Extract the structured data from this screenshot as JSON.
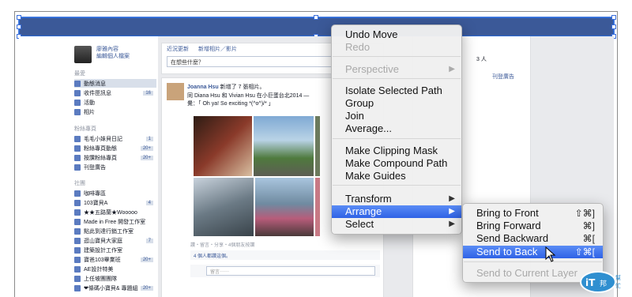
{
  "context_menu": {
    "items": [
      {
        "label": "Undo Move",
        "disabled": false
      },
      {
        "label": "Redo",
        "disabled": true
      },
      {
        "label": "Perspective",
        "disabled": true,
        "submenu": true
      },
      {
        "label": "Isolate Selected Path",
        "disabled": false
      },
      {
        "label": "Group",
        "disabled": false
      },
      {
        "label": "Join",
        "disabled": false
      },
      {
        "label": "Average...",
        "disabled": false
      },
      {
        "label": "Make Clipping Mask",
        "disabled": false
      },
      {
        "label": "Make Compound Path",
        "disabled": false
      },
      {
        "label": "Make Guides",
        "disabled": false
      },
      {
        "label": "Transform",
        "disabled": false,
        "submenu": true
      },
      {
        "label": "Arrange",
        "highlighted": true,
        "submenu": true
      },
      {
        "label": "Select",
        "disabled": false,
        "submenu": true
      }
    ]
  },
  "arrange_submenu": {
    "items": [
      {
        "label": "Bring to Front",
        "shortcut": "⇧⌘]"
      },
      {
        "label": "Bring Forward",
        "shortcut": "⌘]"
      },
      {
        "label": "Send Backward",
        "shortcut": "⌘["
      },
      {
        "label": "Send to Back",
        "shortcut": "⇧⌘[",
        "highlighted": true
      },
      {
        "label": "Send to Current Layer",
        "disabled": true
      }
    ]
  },
  "facebook": {
    "profile_line1": "廖雅內容",
    "profile_line2": "編輯個人檔案",
    "section_favorites": "最愛",
    "nav": [
      {
        "label": "動態消息",
        "active": true
      },
      {
        "label": "收件匣訊息",
        "count": "16"
      },
      {
        "label": "活動"
      },
      {
        "label": "相片"
      }
    ],
    "section_pages": "粉絲專頁",
    "pages": [
      {
        "label": "毛毛小妹貝日記",
        "count": "1"
      },
      {
        "label": "粉絲專頁動態",
        "count": "20+"
      },
      {
        "label": "按讚粉絲專頁",
        "count": "20+"
      },
      {
        "label": "刊登廣告"
      }
    ],
    "section_groups": "社團",
    "groups": [
      {
        "label": "咖啡專區"
      },
      {
        "label": "103寶貝A",
        "count": "4"
      },
      {
        "label": "★★五路蘭★Wooooo"
      },
      {
        "label": "Made in Free 開發工作室"
      },
      {
        "label": "點此到達行銷工作室"
      },
      {
        "label": "逛山寶貝大家庭",
        "count": "7"
      },
      {
        "label": "建築設計工作室"
      },
      {
        "label": "寶爸103畢業班",
        "count": "20+"
      },
      {
        "label": "AE設計特美"
      },
      {
        "label": "上任坡團團隊"
      },
      {
        "label": "❤條碼小寶貝&  專題組",
        "count": "20+"
      }
    ],
    "composer_tabs": [
      "近況更新",
      "新增相片／影片"
    ],
    "composer_placeholder": "在想些什麼？",
    "post_author": "Joanna Hsu",
    "post_action": " 新增了 7 張相片。",
    "post_text": "同 Diana Hsu 和 Vivian Hsu 在小巨蛋台北2014 —\n覺：「 Oh ya! So exciting *(^o^)/* 」",
    "post_footer": "讚・留言・分享・4個朋友按讚",
    "post_likes": "4 個人都讚這個。",
    "comment_placeholder": "留言⋯⋯",
    "right_lines": [
      "3 人",
      "刊登廣告"
    ],
    "colors": {
      "fb_blue": "#3b5998",
      "menu_highlight": "#3a6fe8"
    }
  },
  "watermark": {
    "text": "iT邦幫忙"
  }
}
